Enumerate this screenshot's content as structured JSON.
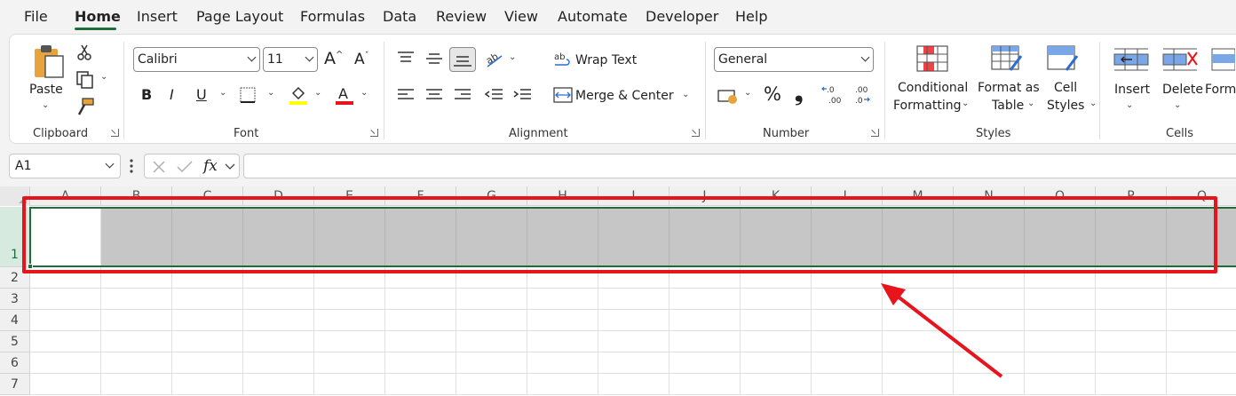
{
  "menu": {
    "tabs": [
      "File",
      "Home",
      "Insert",
      "Page Layout",
      "Formulas",
      "Data",
      "Review",
      "View",
      "Automate",
      "Developer",
      "Help"
    ],
    "active": "Home"
  },
  "ribbon": {
    "clipboard": {
      "paste_label": "Paste",
      "group_label": "Clipboard"
    },
    "font": {
      "font_name": "Calibri",
      "font_size": "11",
      "group_label": "Font",
      "bold": "B",
      "italic": "I",
      "underline": "U"
    },
    "alignment": {
      "wrap_text": "Wrap Text",
      "merge_center": "Merge & Center",
      "group_label": "Alignment"
    },
    "number": {
      "format": "General",
      "percent": "%",
      "comma": "❟",
      "group_label": "Number"
    },
    "styles": {
      "conditional_1": "Conditional",
      "conditional_2": "Formatting",
      "format_table_1": "Format as",
      "format_table_2": "Table",
      "cell_styles_1": "Cell",
      "cell_styles_2": "Styles",
      "group_label": "Styles"
    },
    "cells": {
      "insert": "Insert",
      "delete": "Delete",
      "format": "Form",
      "group_label": "Cells"
    }
  },
  "formula_bar": {
    "name_box": "A1",
    "fx": "fx",
    "value": ""
  },
  "grid": {
    "columns": [
      "A",
      "B",
      "C",
      "D",
      "E",
      "F",
      "G",
      "H",
      "I",
      "J",
      "K",
      "L",
      "M",
      "N",
      "O",
      "P",
      "Q"
    ],
    "rows": [
      "1",
      "2",
      "3",
      "4",
      "5",
      "6",
      "7"
    ]
  },
  "colors": {
    "accent": "#1e6e3a",
    "annotation": "#e8141c",
    "selection": "#c6c6c6"
  }
}
